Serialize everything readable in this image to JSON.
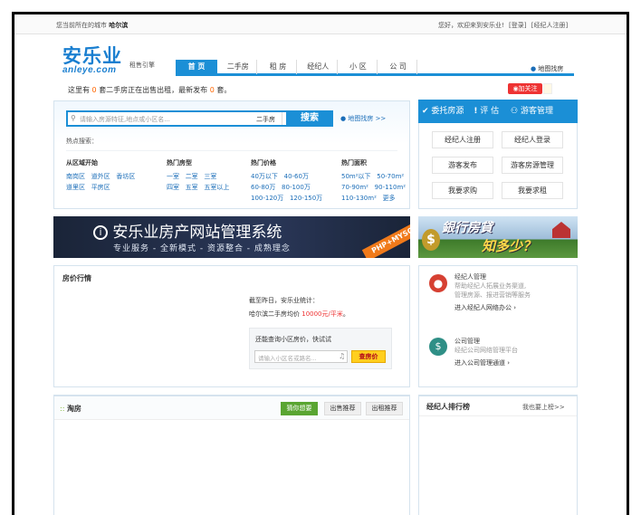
{
  "topbar": {
    "city_prefix": "您当前所在的城市",
    "city": "哈尔滨",
    "welcome": "您好，欢迎来到安乐业!",
    "login": "[登录]",
    "register": "[经纪人注册]"
  },
  "logo": {
    "cn": "安乐业",
    "en": "anleye.com",
    "slogan": "租售引擎"
  },
  "nav": {
    "items": [
      "首 页",
      "二手房",
      "租 房",
      "经纪人",
      "小 区",
      "公 司"
    ],
    "map_link": "地图找房"
  },
  "stats": {
    "part1": "这里有",
    "sale_count": "0",
    "part2": "套二手房正在出售出租，最新发布",
    "new_count": "0",
    "part3": "套。",
    "follow_label": "加关注"
  },
  "search": {
    "placeholder": "请输入房源特征,地点或小区名...",
    "type": "二手房",
    "button": "搜索",
    "map_link": "地图找房 >>",
    "hot_label": "热点搜索："
  },
  "hot": {
    "area_title": "从区域开始",
    "areas": [
      "南岗区",
      "道外区",
      "香坊区",
      "道里区",
      "平房区"
    ],
    "type_title": "热门房型",
    "types": [
      "一室",
      "二室",
      "三室",
      "四室",
      "五室",
      "五室以上"
    ],
    "price_title": "热门价格",
    "prices": [
      "40万以下",
      "40-60万",
      "60-80万",
      "80-100万",
      "100-120万",
      "120-150万"
    ],
    "size_title": "热门面积",
    "sizes": [
      "50m²以下",
      "50-70m²",
      "70-90m²",
      "90-110m²",
      "110-130m²",
      "更多"
    ]
  },
  "tabs": {
    "entrust": "委托房源",
    "estimate": "评 估",
    "guest": "游客管理"
  },
  "quick": [
    "经纪人注册",
    "经纪人登录",
    "游客发布",
    "游客房源管理",
    "我要求购",
    "我要求租"
  ],
  "banner": {
    "title": "安乐业房产网站管理系统",
    "subtitle": "专业服务 - 全新模式 - 资源整合 - 成熟理念",
    "badge": "PHP+MYSQ"
  },
  "ad": {
    "line1": "銀行房貸",
    "line2": "知多少？"
  },
  "price_section": {
    "title": "房价行情",
    "as_of": "截至昨日，安乐业统计：",
    "avg_prefix": "哈尔滨二手房均价",
    "avg_value": "10000元/平米",
    "avg_suffix": "。",
    "query_label": "还能查询小区房价，快试试",
    "query_placeholder": "请输入小区名或路名...",
    "query_button": "查房价"
  },
  "agent_panel": {
    "mgmt_title": "经纪人管理",
    "mgmt_desc1": "帮助经纪人拓展业务渠道,",
    "mgmt_desc2": "管理房源、报进营销等服务",
    "mgmt_link": "进入经纪人网络办公",
    "company_title": "公司管理",
    "company_desc": "经纪公司网络管理平台",
    "company_link": "进入公司管理通道"
  },
  "taofang": {
    "title": "淘房",
    "tabs": [
      "猜你想要",
      "出售推荐",
      "出租推荐"
    ]
  },
  "rank": {
    "title": "经纪人排行榜",
    "link": "我也要上榜>>"
  }
}
